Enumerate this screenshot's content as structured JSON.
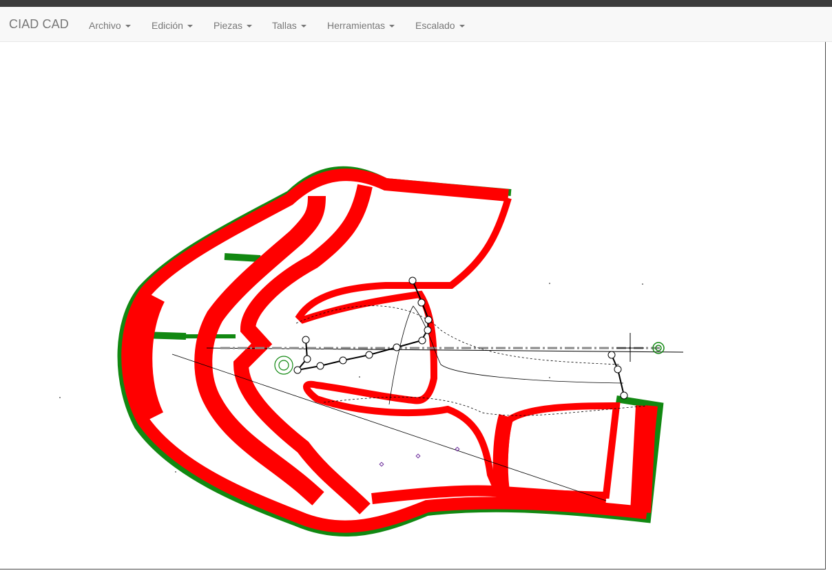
{
  "app": {
    "brand": "CIAD CAD"
  },
  "menu": [
    {
      "id": "archivo",
      "label": "Archivo"
    },
    {
      "id": "edicion",
      "label": "Edición"
    },
    {
      "id": "piezas",
      "label": "Piezas"
    },
    {
      "id": "tallas",
      "label": "Tallas"
    },
    {
      "id": "herramientas",
      "label": "Herramientas"
    },
    {
      "id": "escalado",
      "label": "Escalado"
    }
  ],
  "colors": {
    "topbar": "#3c3c3c",
    "navbar_bg": "#f8f8f8",
    "menu_text": "#777777",
    "pattern_red": "#ff0000",
    "pattern_green": "#118811",
    "guide_line": "#000000"
  }
}
